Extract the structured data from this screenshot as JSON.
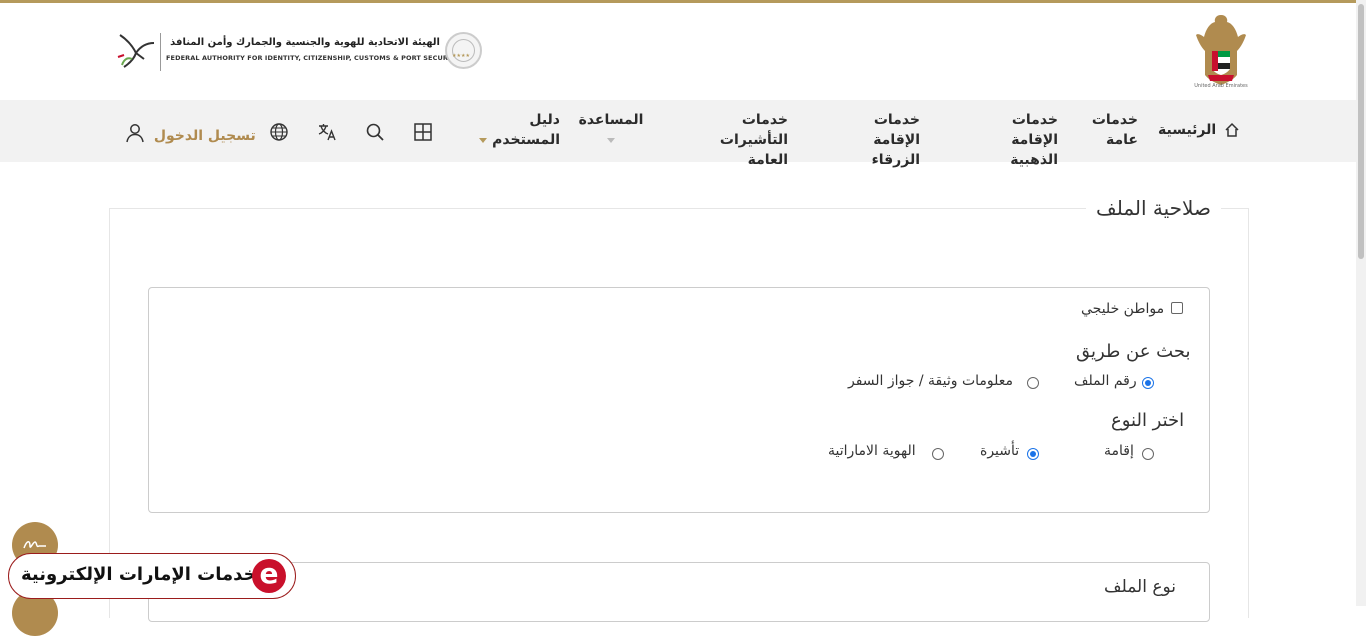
{
  "header": {
    "emblem_caption": "United Arab Emirates",
    "authority_name_ar": "الهيئة الاتحادية للهوية والجنسية والجمارك وأمن المنافذ",
    "authority_name_en": "FEDERAL AUTHORITY FOR IDENTITY, CITIZENSHIP, CUSTOMS & PORT SECURITY"
  },
  "nav": {
    "home": "الرئيسية",
    "general_services_1": "خدمات",
    "general_services_2": "عامة",
    "golden_residency_1": "خدمات الإقامة",
    "golden_residency_2": "الذهبية",
    "blue_residency_1": "خدمات الإقامة",
    "blue_residency_2": "الزرقاء",
    "public_visa_1": "خدمات التأشيرات",
    "public_visa_2": "العامة",
    "help": "المساعدة",
    "user_guide_1": "دليل",
    "user_guide_2": "المستخدم",
    "login": "تسجيل الدخول"
  },
  "form": {
    "legend": "صلاحية الملف",
    "gcc_citizen": "مواطن خليجي",
    "search_by_title": "بحث عن طريق",
    "search_by_file": "رقم الملف",
    "search_by_doc": "معلومات وثيقة / جواز السفر",
    "type_title": "اختر النوع",
    "type_residence": "إقامة",
    "type_visa": "تأشيرة",
    "type_eid": "الهوية الاماراتية",
    "file_type_title": "نوع الملف",
    "selected_search": "رقم الملف",
    "selected_type": "تأشيرة",
    "gcc_checked": false
  },
  "floating": {
    "eservices_label": "خدمات الإمارات الإلكترونية",
    "eservices_letter": "e"
  },
  "colors": {
    "gold": "#b59a5c",
    "nav_bg": "#f2f2f2",
    "radio_selected": "#1a73e8",
    "eservices_red": "#c9102b"
  }
}
